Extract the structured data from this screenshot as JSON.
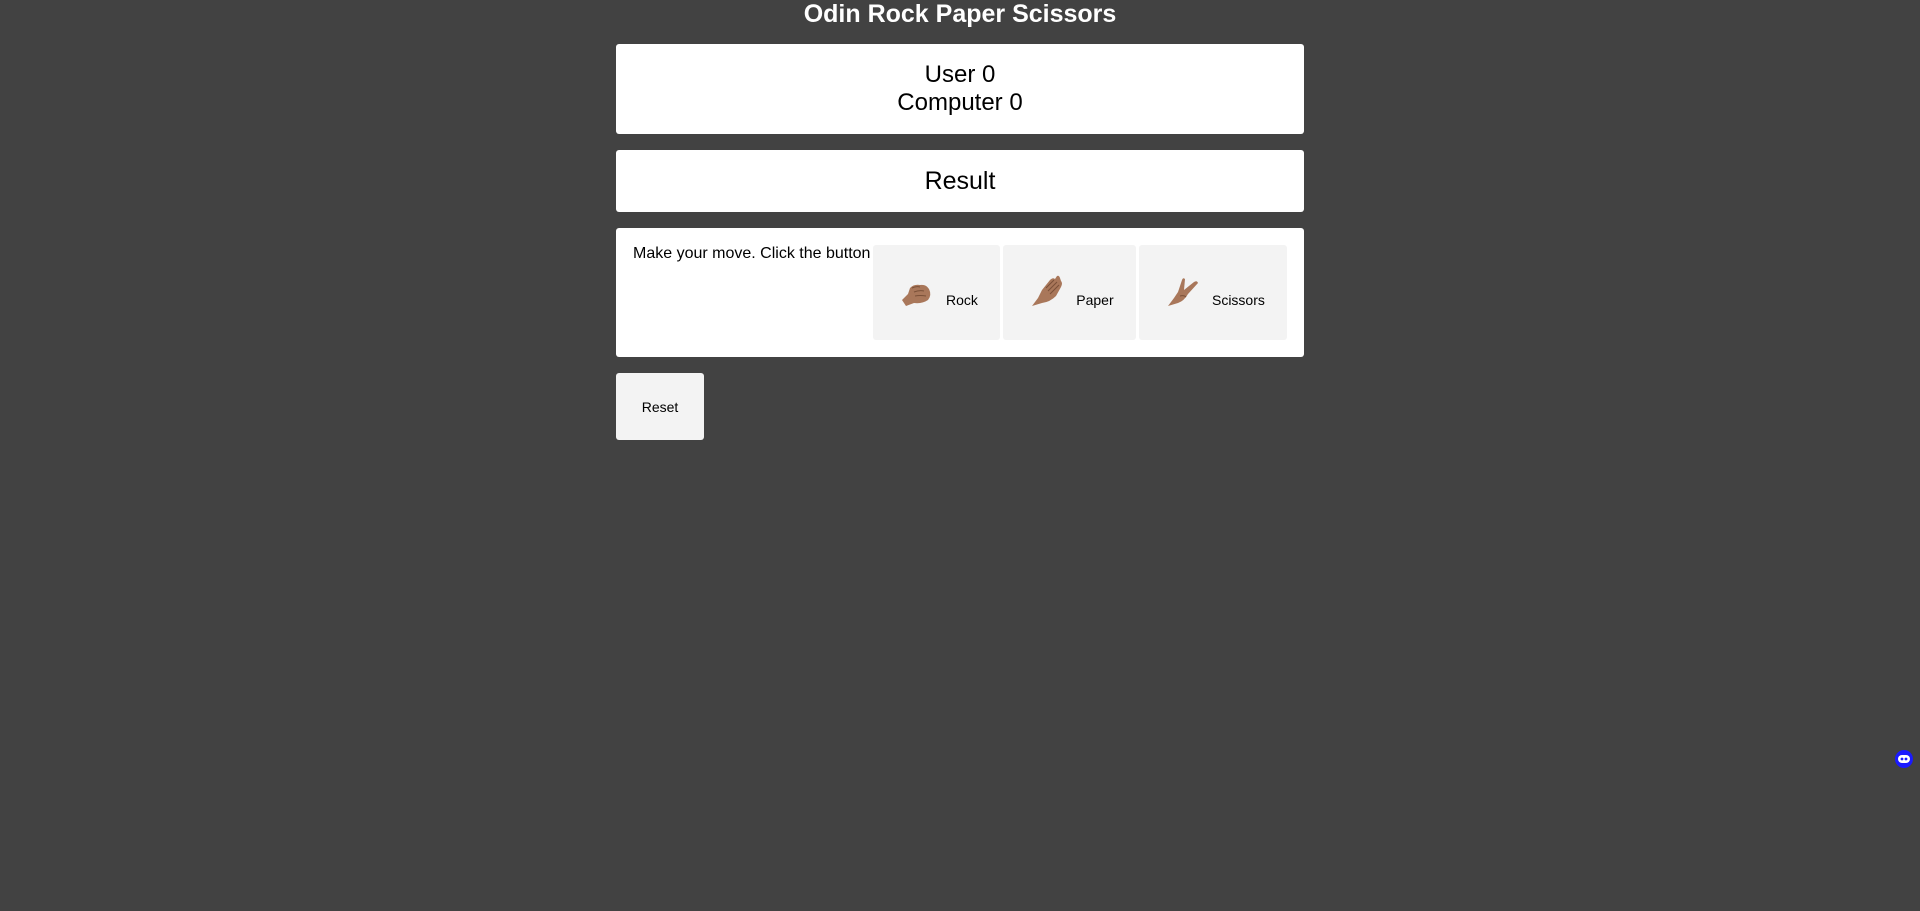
{
  "header": {
    "title": "Odin Rock Paper Scissors"
  },
  "score": {
    "user": "User 0",
    "computer": "Computer 0"
  },
  "result": {
    "text": "Result"
  },
  "moves": {
    "prompt": "Make your move. Click the button",
    "rock_label": "Rock",
    "paper_label": "Paper",
    "scissors_label": "Scissors"
  },
  "controls": {
    "reset_label": "Reset"
  },
  "icons": {
    "rock": "rock-hand-icon",
    "paper": "paper-hand-icon",
    "scissors": "scissors-hand-icon",
    "extension": "extension-icon"
  },
  "colors": {
    "background": "#424242",
    "panel": "#ffffff",
    "button": "#f3f3f3",
    "skin": "#a9775a"
  }
}
